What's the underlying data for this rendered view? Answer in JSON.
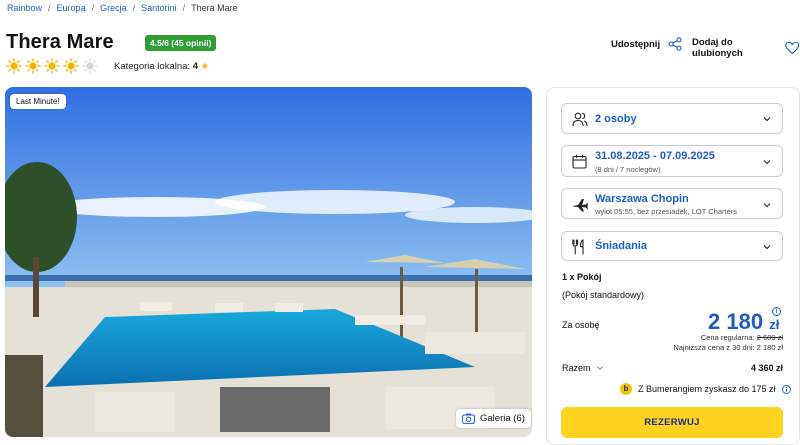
{
  "breadcrumb": [
    "Rainbow",
    "Europa",
    "Grecja",
    "Santorini",
    "Thera Mare"
  ],
  "hotel": {
    "name": "Thera Mare",
    "rating_badge": "4.5/6 (45 opinii)",
    "suns_filled": 4,
    "suns_total": 5,
    "local_category_label": "Kategoria lokalna:",
    "local_category_value": "4",
    "local_category_star": "★"
  },
  "actions": {
    "share": "Udostępnij",
    "favorite": "Dodaj do ulubionych"
  },
  "photo": {
    "badge": "Last Minute!",
    "gallery_label": "Galeria (6)"
  },
  "booking": {
    "guests": "2 osoby",
    "dates": "31.08.2025 - 07.09.2025",
    "dates_sub": "(8 dni / 7 noclegów)",
    "airport": "Warszawa Chopin",
    "airport_sub": "wylot 05:55, bez przesiadek, LOT Charters",
    "board": "Śniadania",
    "room_count": "1 x Pokój",
    "room_type": "(Pokój standardowy)",
    "per_person_label": "Za osobę",
    "price": "2 180",
    "currency": "zł",
    "regular_label": "Cena regularna:",
    "regular_price": "2 680 zł",
    "lowest_label": "Najniższa cena z 30 dni:",
    "lowest_price": "2 180 zł",
    "total_label": "Razem",
    "total": "4 360 zł",
    "bumerang": "Z Bumerangiem zyskasz do 175 zł",
    "bumerang_logo": "b",
    "info_icon": "i",
    "cta": "REZERWUJ"
  },
  "colors": {
    "accent": "#1f5cc5",
    "badge_green": "#2f9e35",
    "cta_yellow": "#ffd21e",
    "sun": "#f5b400"
  }
}
